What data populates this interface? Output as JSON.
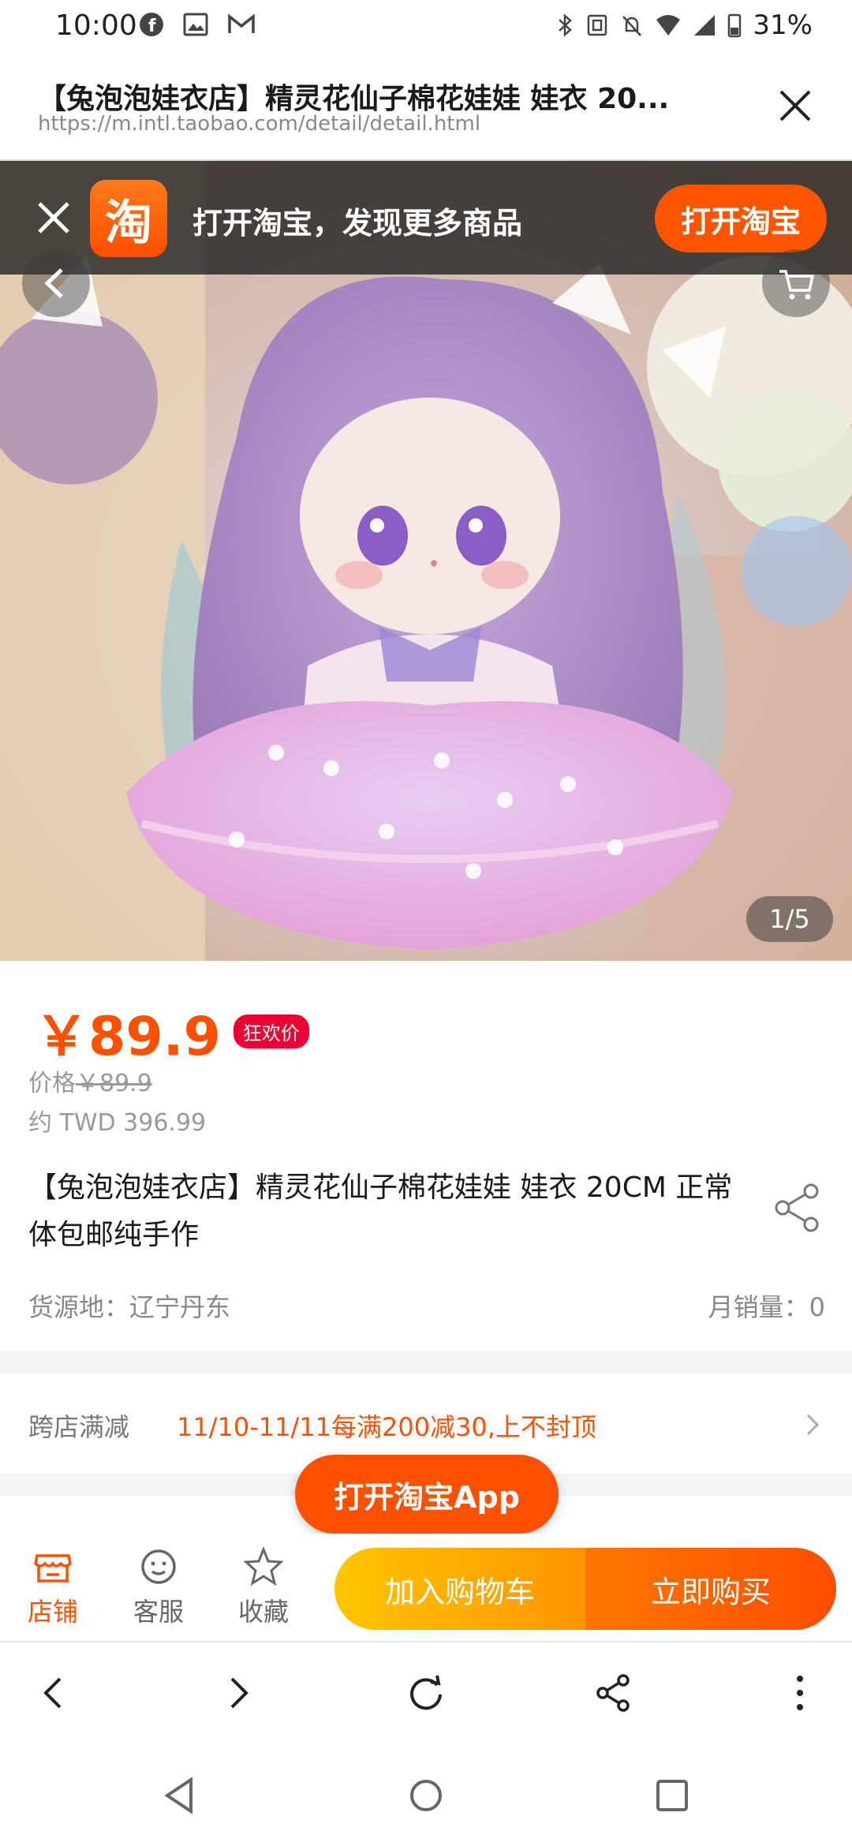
{
  "status_bar": {
    "time": "10:00",
    "battery": "31%"
  },
  "browser": {
    "page_title": "【兔泡泡娃衣店】精灵花仙子棉花娃娃 娃衣 20...",
    "url": "https://m.intl.taobao.com/detail/detail.html"
  },
  "open_banner": {
    "logo_char": "淘",
    "text": "打开淘宝，发现更多商品",
    "button": "打开淘宝"
  },
  "gallery": {
    "counter": "1/5"
  },
  "product": {
    "price": "￥89.9",
    "price_tag": "狂欢价",
    "orig_label": "价格",
    "orig_price": "￥89.9",
    "twd": "约 TWD 396.99",
    "title": "【兔泡泡娃衣店】精灵花仙子棉花娃娃 娃衣 20CM 正常体包邮纯手作",
    "origin": "货源地：辽宁丹东",
    "monthly_sales": "月销量：0"
  },
  "promo": {
    "label": "跨店满减",
    "text": "11/10-11/11每满200减30,上不封顶"
  },
  "floating_button": "打开淘宝App",
  "bottom_bar": {
    "store": "店铺",
    "service": "客服",
    "favorite": "收藏",
    "add_to_cart": "加入购物车",
    "buy_now": "立即购买"
  },
  "colors": {
    "accent": "#ff5000",
    "tag_red": "#ee0033",
    "cart_yellow": "#ffb300"
  }
}
